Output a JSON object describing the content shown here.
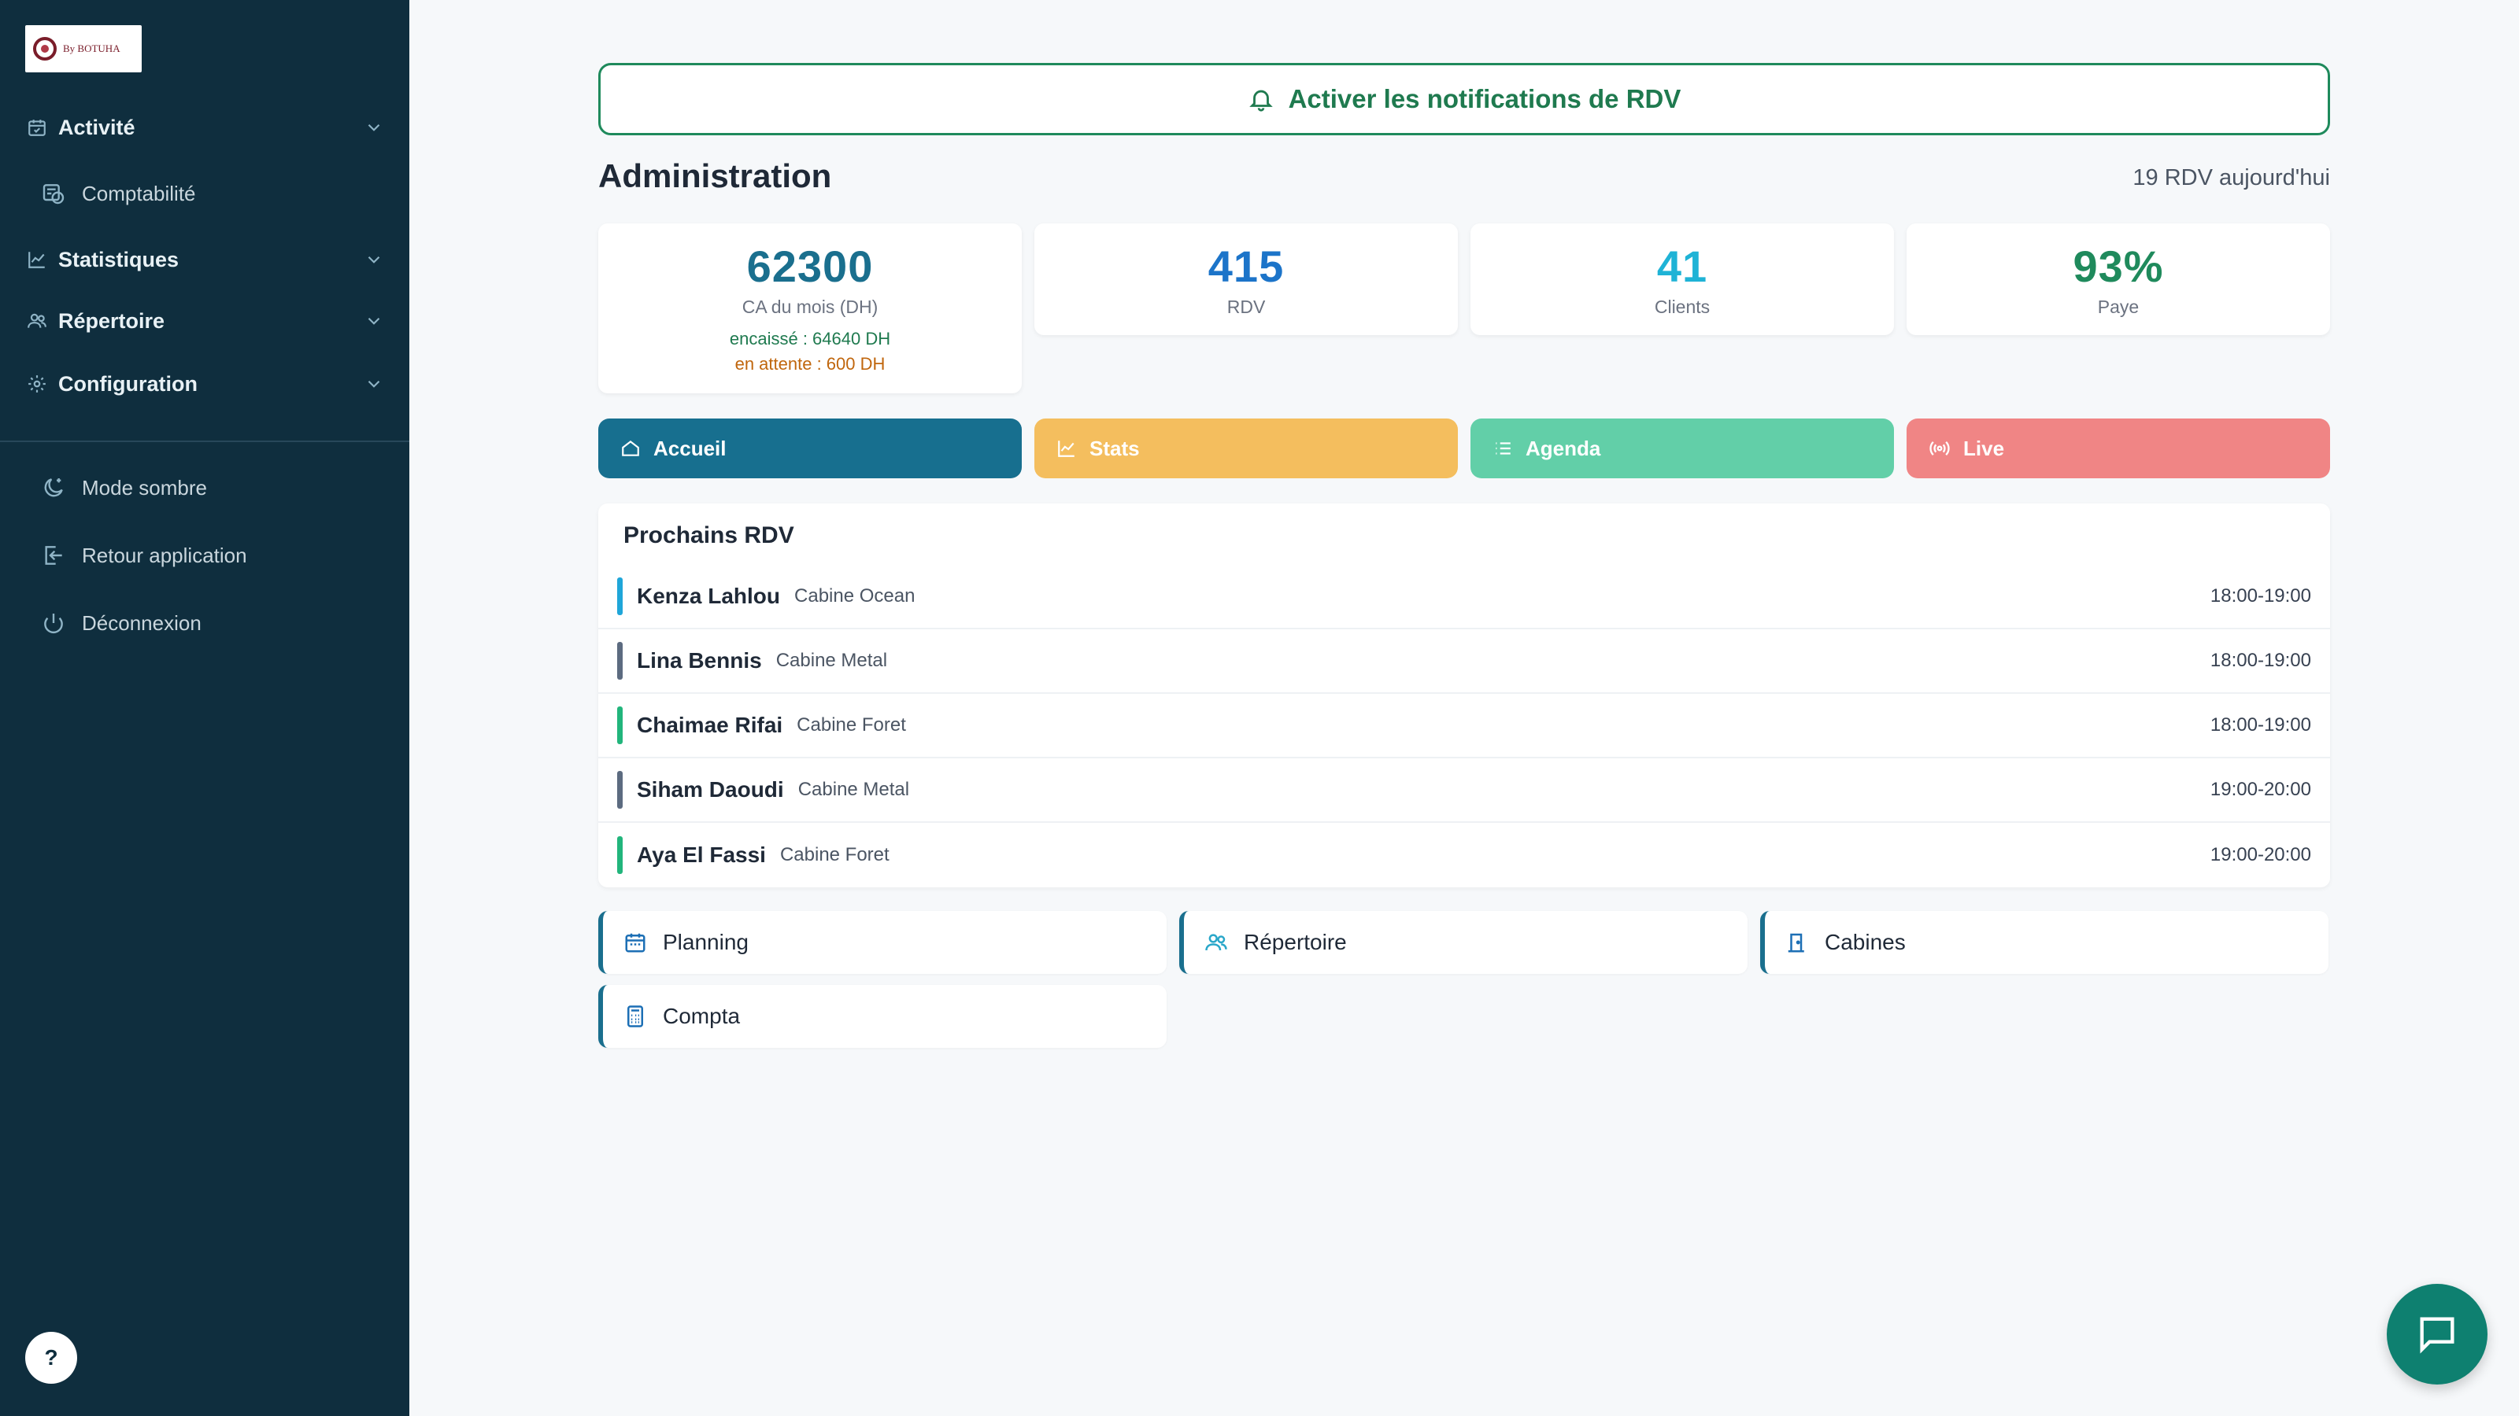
{
  "sidebar": {
    "logo_text": "By BOTUHA",
    "items": [
      {
        "label": "Activité",
        "icon": "calendar-check-icon"
      },
      {
        "label": "Statistiques",
        "icon": "chart-line-icon"
      },
      {
        "label": "Répertoire",
        "icon": "users-icon"
      },
      {
        "label": "Configuration",
        "icon": "gear-icon"
      }
    ],
    "sub_items": [
      {
        "label": "Comptabilité",
        "icon": "accounting-icon"
      }
    ],
    "bottom_items": [
      {
        "label": "Mode sombre",
        "icon": "moon-icon"
      },
      {
        "label": "Retour application",
        "icon": "exit-icon"
      },
      {
        "label": "Déconnexion",
        "icon": "power-icon"
      }
    ],
    "help_label": "?"
  },
  "notification": {
    "label": "Activer les notifications de RDV",
    "icon": "bell-icon"
  },
  "header": {
    "title": "Administration",
    "subtitle": "19 RDV aujourd'hui"
  },
  "stats": [
    {
      "value": "62300",
      "label": "CA du mois (DH)",
      "line1": "encaissé : 64640 DH",
      "line2": "en attente : 600 DH",
      "color": "#1a6f8e"
    },
    {
      "value": "415",
      "label": "RDV",
      "color": "#1c74c9"
    },
    {
      "value": "41",
      "label": "Clients",
      "color": "#1fb3d6"
    },
    {
      "value": "93%",
      "label": "Paye",
      "color": "#1f8a5c"
    }
  ],
  "actions": [
    {
      "label": "Accueil",
      "icon": "home-icon",
      "color": "#176f8f"
    },
    {
      "label": "Stats",
      "icon": "chart-icon",
      "color": "#f4be5e"
    },
    {
      "label": "Agenda",
      "icon": "list-icon",
      "color": "#62cfa8"
    },
    {
      "label": "Live",
      "icon": "broadcast-icon",
      "color": "#f08585"
    }
  ],
  "upcoming": {
    "title": "Prochains RDV",
    "rows": [
      {
        "name": "Kenza Lahlou",
        "cabin": "Cabine Ocean",
        "time": "18:00-19:00",
        "color": "#1fa6d9"
      },
      {
        "name": "Lina Bennis",
        "cabin": "Cabine Metal",
        "time": "18:00-19:00",
        "color": "#5c6b80"
      },
      {
        "name": "Chaimae Rifai",
        "cabin": "Cabine Foret",
        "time": "18:00-19:00",
        "color": "#22b57c"
      },
      {
        "name": "Siham Daoudi",
        "cabin": "Cabine Metal",
        "time": "19:00-20:00",
        "color": "#5c6b80"
      },
      {
        "name": "Aya El Fassi",
        "cabin": "Cabine Foret",
        "time": "19:00-20:00",
        "color": "#22b57c"
      }
    ]
  },
  "quick_links": [
    {
      "label": "Planning",
      "icon": "calendar-icon"
    },
    {
      "label": "Répertoire",
      "icon": "users-icon"
    },
    {
      "label": "Cabines",
      "icon": "door-icon"
    },
    {
      "label": "Compta",
      "icon": "calculator-icon"
    }
  ],
  "chat": {
    "icon": "chat-icon"
  }
}
